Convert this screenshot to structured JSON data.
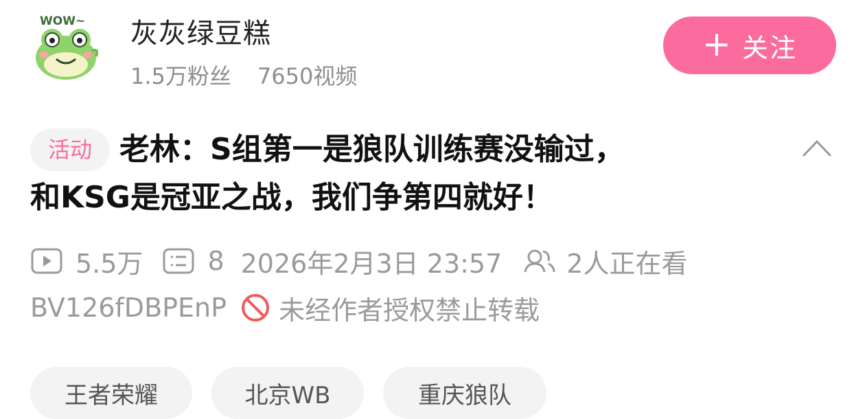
{
  "uploader": {
    "name": "灰灰绿豆糕",
    "fans": "1.5万粉丝",
    "videos": "7650视频",
    "avatar_text": "WOW~"
  },
  "follow_button": {
    "label": "关注",
    "color": "#fb6b9d"
  },
  "video": {
    "tag": "活动",
    "title_line1": "老林：S组第一是狼队训练赛没输过，",
    "title_line2": "和KSG是冠亚之战，我们争第四就好！",
    "views": "5.5万",
    "comments": "8",
    "publish_time": "2026年2月3日 23:57",
    "watching": "2人正在看",
    "bvid": "BV126fDBPEnP",
    "copyright_notice": "未经作者授权禁止转载"
  },
  "tags": [
    "王者荣耀",
    "北京WB",
    "重庆狼队"
  ],
  "icons": {
    "views": "play-icon",
    "comments": "comment-icon",
    "watching": "people-icon",
    "copyright": "no-repost-icon",
    "collapse": "chevron-up-icon"
  },
  "colors": {
    "accent": "#fb6b9d",
    "meta_text": "#9a9a9a",
    "no_repost": "#f05a5a"
  }
}
